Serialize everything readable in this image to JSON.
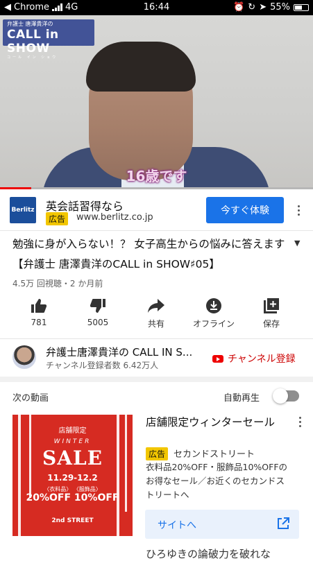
{
  "status_bar": {
    "carrier": "Chrome",
    "network": "4G",
    "time": "16:44",
    "battery": "55%"
  },
  "video": {
    "brand_small": "弁護士 唐澤貴洋の",
    "brand_main": "CALL in SHOW",
    "brand_ruby": "コール イン ショウ",
    "caption": "16歳です",
    "progress_fraction": 0.1
  },
  "ad": {
    "logo_text": "Berlitz",
    "title": "英会話習得なら",
    "badge": "広告",
    "url": "www.berlitz.co.jp",
    "cta": "今すぐ体験"
  },
  "video_info": {
    "title": "勉強に身が入らない！？ 女子高生からの悩みに答えます【弁護士 唐澤貴洋のCALL in SHOW♯05】",
    "meta": "4.5万 回視聴・2 か月前"
  },
  "actions": [
    {
      "icon": "thumb-up-icon",
      "label": "781"
    },
    {
      "icon": "thumb-down-icon",
      "label": "5005"
    },
    {
      "icon": "share-icon",
      "label": "共有"
    },
    {
      "icon": "download-icon",
      "label": "オフライン"
    },
    {
      "icon": "add-to-playlist-icon",
      "label": "保存"
    }
  ],
  "channel": {
    "name": "弁護士唐澤貴洋の CALL IN S...",
    "subscribers": "チャンネル登録者数 6.42万人",
    "subscribe_label": "チャンネル登録"
  },
  "up_next": {
    "label": "次の動画",
    "autoplay_label": "自動再生",
    "autoplay_on": false
  },
  "next_ad": {
    "title": "店舗限定ウィンターセール",
    "badge": "広告",
    "advertiser": "セカンドストリート",
    "description": "衣料品20%OFF・服飾品10%OFFのお得なセール／お近くのセカンドストリートへ",
    "site_button": "サイトへ",
    "thumbnail": {
      "line1": "店舗限定",
      "line2": "WINTER",
      "line3": "SALE",
      "line4": "11.29-12.2",
      "line5": "〈衣料品〉 〈服飾品〉",
      "line6": "20%OFF 10%OFF",
      "line7": "2nd STREET"
    }
  },
  "next_peek": "ひろゆきの論破力を破れな"
}
